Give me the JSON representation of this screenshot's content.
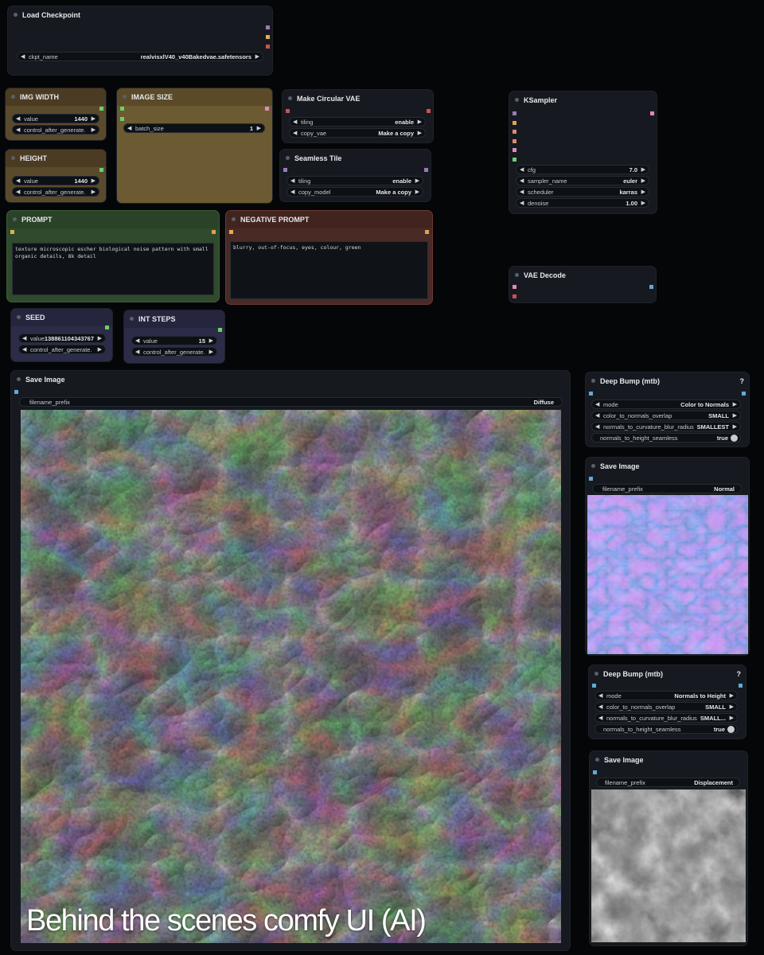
{
  "load_checkpoint": {
    "title": "Load Checkpoint",
    "ckpt_label": "ckpt_name",
    "ckpt_value": "realvisxlV40_v40Bakedvae.safetensors"
  },
  "img_width": {
    "title": "IMG WIDTH",
    "value_label": "value",
    "value": "1440",
    "control_label": "control_after_generate."
  },
  "height": {
    "title": "HEIGHT",
    "value_label": "value",
    "value": "1440",
    "control_label": "control_after_generate."
  },
  "image_size": {
    "title": "IMAGE SIZE",
    "batch_label": "batch_size",
    "batch_value": "1"
  },
  "circular_vae": {
    "title": "Make Circular VAE",
    "tiling_label": "tiling",
    "tiling_value": "enable",
    "copy_label": "copy_vae",
    "copy_value": "Make a copy"
  },
  "seamless_tile": {
    "title": "Seamless Tile",
    "tiling_label": "tiling",
    "tiling_value": "enable",
    "copy_label": "copy_model",
    "copy_value": "Make a copy"
  },
  "ksampler": {
    "title": "KSampler",
    "cfg_label": "cfg",
    "cfg_value": "7.0",
    "sampler_label": "sampler_name",
    "sampler_value": "euler",
    "scheduler_label": "scheduler",
    "scheduler_value": "karras",
    "denoise_label": "denoise",
    "denoise_value": "1.00"
  },
  "prompt": {
    "title": "PROMPT",
    "text": "texture microscopic escher biological noise pattern with small organic details, 8k detail"
  },
  "negative_prompt": {
    "title": "NEGATIVE PROMPT",
    "text": "blurry, out-of-focus, eyes, colour, green"
  },
  "vae_decode": {
    "title": "VAE Decode"
  },
  "seed": {
    "title": "SEED",
    "value_label": "value",
    "value": "138861104343767",
    "control_label": "control_after_generate."
  },
  "int_steps": {
    "title": "INT STEPS",
    "value_label": "value",
    "value": "15",
    "control_label": "control_after_generate."
  },
  "save_main": {
    "title": "Save Image",
    "prefix_label": "filename_prefix",
    "prefix_value": "Diffuse"
  },
  "deep_bump_1": {
    "title": "Deep Bump (mtb)",
    "help": "?",
    "mode_label": "mode",
    "mode_value": "Color to Normals",
    "overlap_label": "color_to_normals_overlap",
    "overlap_value": "SMALL",
    "blur_label": "normals_to_curvature_blur_radius",
    "blur_value": "SMALLEST",
    "seamless_label": "normals_to_height_seamless",
    "seamless_value": "true"
  },
  "save_normal": {
    "title": "Save Image",
    "prefix_label": "filename_prefix",
    "prefix_value": "Normal"
  },
  "deep_bump_2": {
    "title": "Deep Bump (mtb)",
    "help": "?",
    "mode_label": "mode",
    "mode_value": "Normals to Height",
    "overlap_label": "color_to_normals_overlap",
    "overlap_value": "SMALL",
    "blur_label": "normals_to_curvature_blur_radius",
    "blur_value": "SMALL...",
    "seamless_label": "normals_to_height_seamless",
    "seamless_value": "true"
  },
  "save_disp": {
    "title": "Save Image",
    "prefix_label": "filename_prefix",
    "prefix_value": "Displacement"
  },
  "caption": "Behind the scenes comfy UI (AI)",
  "colors": {
    "node_bg": "#161a20",
    "canvas_bg": "#050608",
    "int_node": "#5a4a2c",
    "prompt_green": "#2f4a2c",
    "prompt_red": "#4a2a26",
    "purple_node": "#2c2c48"
  }
}
